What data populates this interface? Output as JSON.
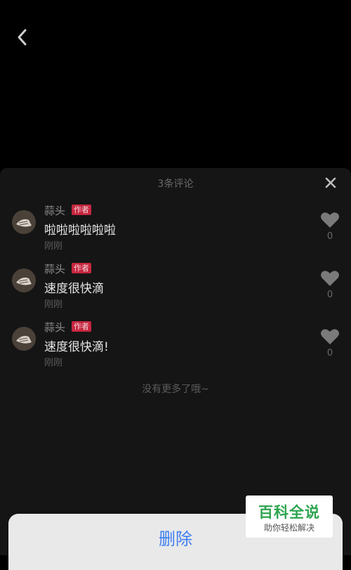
{
  "header": {
    "back_icon": "chevron-left-icon"
  },
  "sheet": {
    "title": "3条评论",
    "close_icon": "close-icon",
    "comments": [
      {
        "username": "蒜头",
        "badge": "作者",
        "text": "啦啦啦啦啦啦",
        "time": "刚刚",
        "likes": "0"
      },
      {
        "username": "蒜头",
        "badge": "作者",
        "text": "速度很快滴",
        "time": "刚刚",
        "likes": "0"
      },
      {
        "username": "蒜头",
        "badge": "作者",
        "text": "速度很快滴!",
        "time": "刚刚",
        "likes": "0"
      }
    ],
    "no_more": "没有更多了哦~"
  },
  "action_sheet": {
    "delete_label": "删除",
    "delete_color": "#3d7ff0"
  },
  "watermark": {
    "title": "百科全说",
    "subtitle": "助你轻松解决"
  }
}
